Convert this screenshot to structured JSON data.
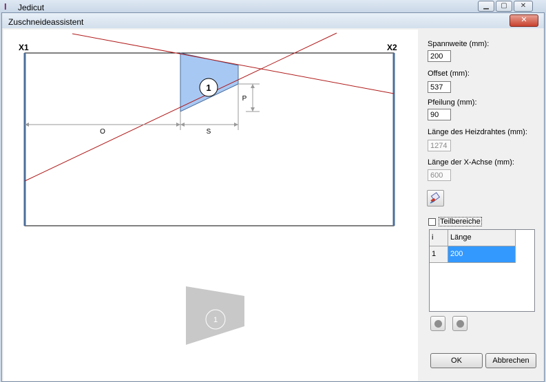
{
  "outer_window": {
    "title": "Jedicut"
  },
  "dialog": {
    "title": "Zuschneideassistent",
    "close_label": "✕"
  },
  "diagram": {
    "x1_label": "X1",
    "x2_label": "X2",
    "piece_number": "1",
    "dim_o": "O",
    "dim_s": "S",
    "dim_p": "P",
    "preview_number": "1",
    "colors": {
      "piece_fill": "#a8c8f4",
      "cut_line": "#b01818",
      "frame": "#4a6d9a",
      "preview_fill": "#c8c8c8"
    }
  },
  "form": {
    "spannweite": {
      "label": "Spannweite (mm):",
      "value": "200"
    },
    "offset": {
      "label": "Offset (mm):",
      "value": "537"
    },
    "pfeilung": {
      "label": "Pfeilung (mm):",
      "value": "90"
    },
    "heizdraht": {
      "label": "Länge des Heizdrahtes (mm):",
      "value": "1274"
    },
    "xachse": {
      "label": "Länge der X-Achse (mm):",
      "value": "600"
    },
    "teilbereiche": {
      "label": "Teilbereiche",
      "checked": false
    }
  },
  "table": {
    "headers": [
      "i",
      "Länge"
    ],
    "rows": [
      {
        "i": "1",
        "laenge": "200"
      }
    ]
  },
  "buttons": {
    "ok": "OK",
    "cancel": "Abbrechen"
  }
}
